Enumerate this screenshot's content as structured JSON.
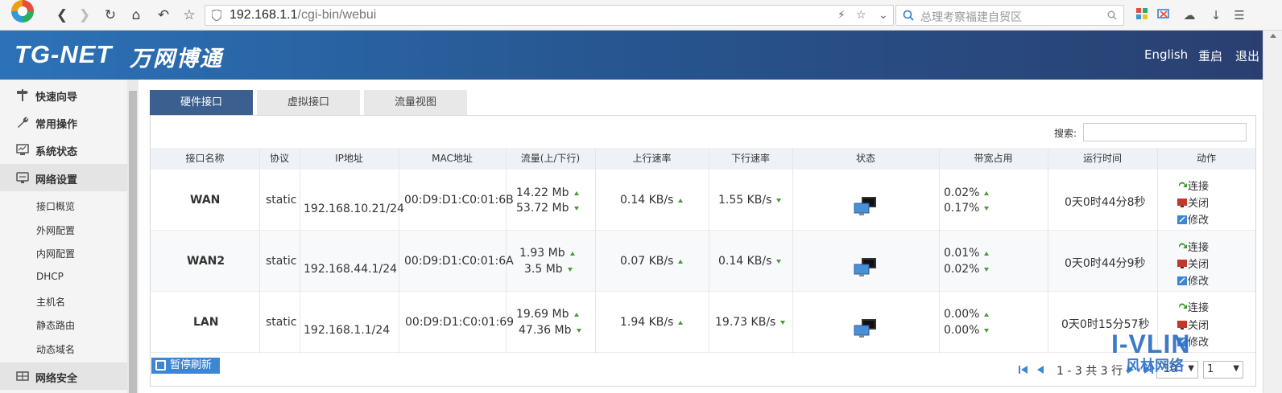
{
  "browser": {
    "url_host": "192.168.1.1",
    "url_path": "/cgi-bin/webui",
    "search_placeholder": "总理考察福建自贸区"
  },
  "header": {
    "logo_text": "TG-NET",
    "logo_cn": "万网博通",
    "links": [
      "English",
      "重启",
      "退出"
    ]
  },
  "sidebar": {
    "groups": [
      {
        "label": "快速向导",
        "icon": "signpost-icon"
      },
      {
        "label": "常用操作",
        "icon": "wrench-icon"
      },
      {
        "label": "系统状态",
        "icon": "monitor-icon"
      },
      {
        "label": "网络设置",
        "icon": "network-icon"
      },
      {
        "label": "网络安全",
        "icon": "shield-icon"
      }
    ],
    "items": [
      "接口概览",
      "外网配置",
      "内网配置",
      "DHCP",
      "主机名",
      "静态路由",
      "动态域名"
    ]
  },
  "tabs": [
    "硬件接口",
    "虚拟接口",
    "流量视图"
  ],
  "search": {
    "label": "搜索:",
    "value": ""
  },
  "table": {
    "headers": [
      "接口名称",
      "协议",
      "IP地址",
      "MAC地址",
      "流量(上/下行)",
      "上行速率",
      "下行速率",
      "状态",
      "带宽占用",
      "运行时间",
      "动作"
    ],
    "rows": [
      {
        "name": "WAN",
        "protocol": "static",
        "ip": "192.168.10.21/24",
        "mac": "00:D9:D1:C0:01:6B",
        "traffic_up": "14.22 Mb",
        "traffic_down": "53.72 Mb",
        "up_rate": "0.14 KB/s",
        "down_rate": "1.55 KB/s",
        "bw_up": "0.02%",
        "bw_down": "0.17%",
        "uptime": "0天0时44分8秒"
      },
      {
        "name": "WAN2",
        "protocol": "static",
        "ip": "192.168.44.1/24",
        "mac": "00:D9:D1:C0:01:6A",
        "traffic_up": "1.93 Mb",
        "traffic_down": "3.5 Mb",
        "up_rate": "0.07 KB/s",
        "down_rate": "0.14 KB/s",
        "bw_up": "0.01%",
        "bw_down": "0.02%",
        "uptime": "0天0时44分9秒"
      },
      {
        "name": "LAN",
        "protocol": "static",
        "ip": "192.168.1.1/24",
        "mac": "00:D9:D1:C0:01:69",
        "traffic_up": "19.69 Mb",
        "traffic_down": "47.36 Mb",
        "up_rate": "1.94 KB/s",
        "down_rate": "19.73 KB/s",
        "bw_up": "0.00%",
        "bw_down": "0.00%",
        "uptime": "0天0时15分57秒"
      }
    ],
    "actions": {
      "connect": "连接",
      "close": "关闭",
      "edit": "修改"
    }
  },
  "footer": {
    "pause_label": "暂停刷新",
    "pager_text": "1 - 3 共 3 行",
    "page_size": "10",
    "page_num": "1"
  },
  "watermark": {
    "line1": "I-VLIN",
    "line2": "风林网络"
  },
  "colors": {
    "header_start": "#2c72b8",
    "header_end": "#2a3f70",
    "tab_active": "#3b5f8f",
    "pause_btn": "#3d86d4"
  }
}
